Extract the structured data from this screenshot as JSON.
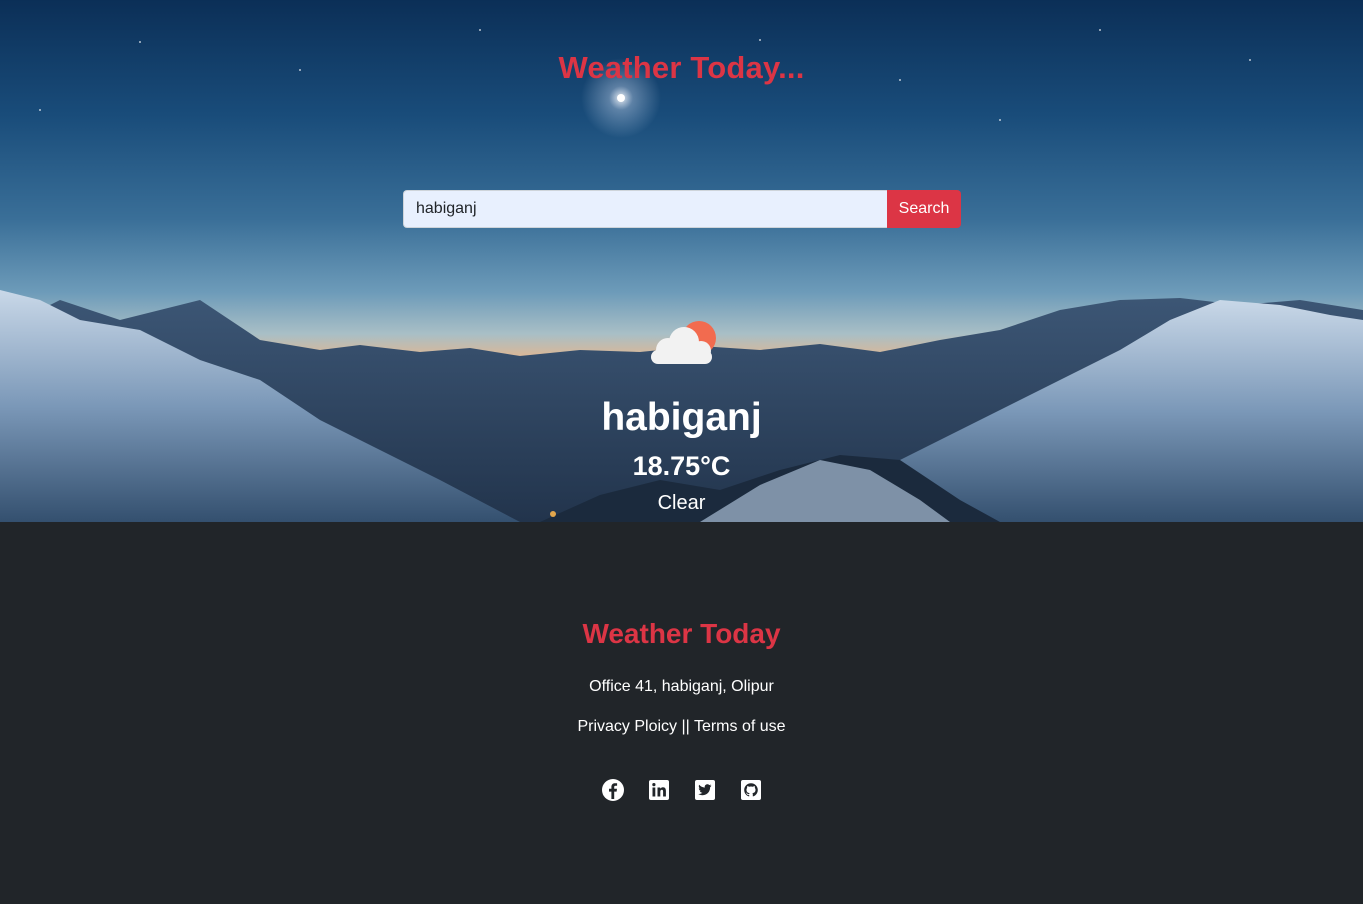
{
  "colors": {
    "accent": "#dc3545",
    "footer_bg": "#212529",
    "input_bg": "#e8f0fe",
    "sun": "#f26b4f",
    "cloud": "#f2f2f2"
  },
  "header": {
    "title": "Weather Today..."
  },
  "search": {
    "value": "habiganj",
    "button_label": "Search"
  },
  "weather": {
    "icon": "partly-cloudy-icon",
    "city": "habiganj",
    "temperature": "18.75°C",
    "condition": "Clear"
  },
  "footer": {
    "title": "Weather Today",
    "address": "Office 41, habiganj, Olipur",
    "privacy_label": "Privacy Ploicy",
    "separator": "||",
    "terms_label": "Terms of use",
    "social": [
      "facebook-icon",
      "linkedin-icon",
      "twitter-icon",
      "github-icon"
    ]
  }
}
